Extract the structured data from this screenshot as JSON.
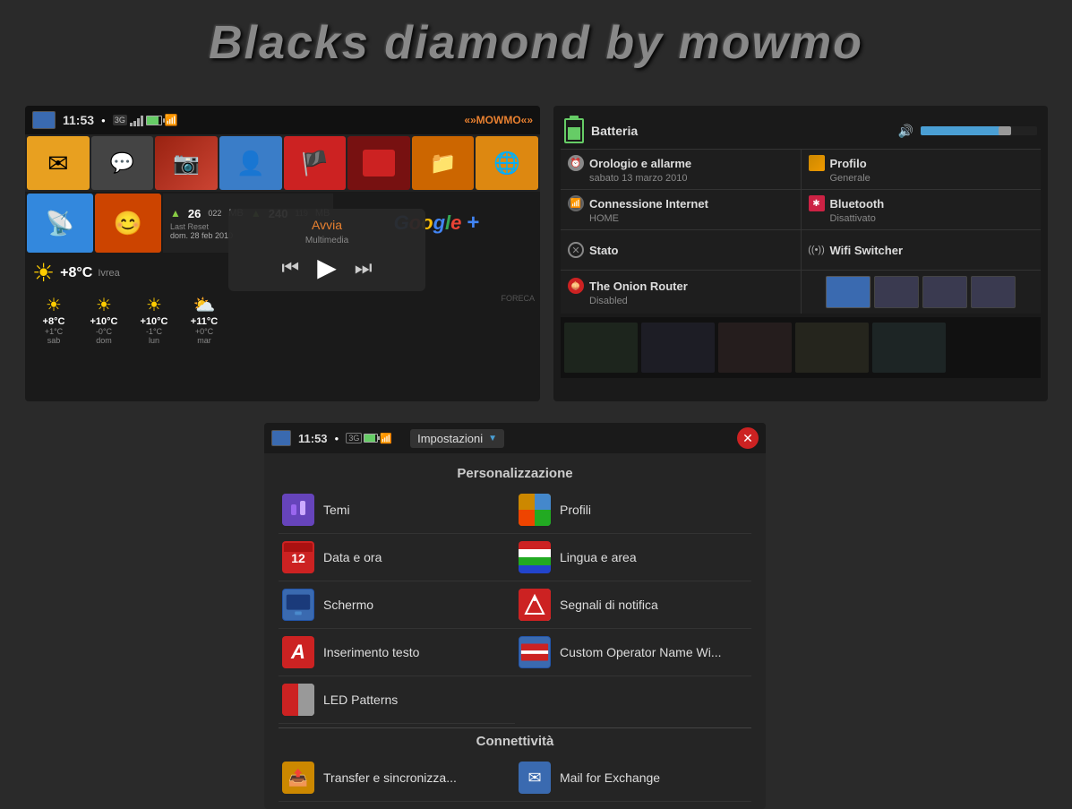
{
  "page": {
    "title": "Blacks diamond by mowmo",
    "bg_color": "#2a2a2a"
  },
  "left_screen": {
    "status_bar": {
      "time": "11:53",
      "dot": "●",
      "operator": "«»MOWMO«»",
      "network": "3G"
    },
    "apps_row1": [
      {
        "label": "Mail",
        "color": "#e8a020"
      },
      {
        "label": "Messages",
        "color": "#555"
      },
      {
        "label": "Contacts-img",
        "color": "#bb4433"
      },
      {
        "label": "Contacts",
        "color": "#3a7dc8"
      },
      {
        "label": "Flag",
        "color": "#cc3333"
      },
      {
        "label": "App",
        "color": "#881122"
      },
      {
        "label": "Files",
        "color": "#cc6600"
      },
      {
        "label": "Globe",
        "color": "#dd8811"
      }
    ],
    "apps_row2": [
      {
        "label": "RSS",
        "color": "#3388dd"
      },
      {
        "label": "Smiley",
        "color": "#cc4400"
      }
    ],
    "memory": {
      "ram_value": "26",
      "ram_sup": "022",
      "ram_unit": "MB",
      "storage_value": "240",
      "storage_sup": "119",
      "storage_unit": "MB",
      "last_reset": "Last Reset",
      "last_reset_date": "dom. 28 feb 2010"
    },
    "weather": {
      "temp": "+8°C",
      "city": "Ivrea"
    },
    "forecast": [
      {
        "day": "sab",
        "temp": "+8°C",
        "delta": "+1°C",
        "icon": "☀"
      },
      {
        "day": "dom",
        "temp": "+10°C",
        "delta": "-0°C",
        "icon": "☀"
      },
      {
        "day": "lun",
        "temp": "+10°C",
        "delta": "-1°C",
        "icon": "☀"
      },
      {
        "day": "mar",
        "temp": "+11°C",
        "delta": "+0°C",
        "icon": "⛅"
      }
    ],
    "foreca": "FORECA"
  },
  "media_popup": {
    "title": "Avvia",
    "subtitle": "Multimedia",
    "prev_btn": "⏮",
    "play_btn": "▶",
    "next_btn": "⏭"
  },
  "right_screen": {
    "battery_label": "Batteria",
    "volume_label": "Volume",
    "settings_items": [
      {
        "title": "Orologio e allarme",
        "subtitle": "sabato 13 marzo 2010",
        "icon_type": "clock"
      },
      {
        "title": "Profilo",
        "subtitle": "Generale",
        "icon_type": "profile"
      },
      {
        "title": "Connessione Internet",
        "subtitle": "HOME",
        "icon_type": "internet"
      },
      {
        "title": "Bluetooth",
        "subtitle": "Disattivato",
        "icon_type": "bluetooth"
      },
      {
        "title": "Stato",
        "subtitle": "",
        "icon_type": "stato"
      },
      {
        "title": "Wifi Switcher",
        "subtitle": "",
        "icon_type": "wifi"
      },
      {
        "title": "The Onion Router",
        "subtitle": "Disabled",
        "icon_type": "tor"
      },
      {
        "title": "",
        "subtitle": "",
        "icon_type": "screen"
      }
    ],
    "thumbnails": [
      "",
      "",
      "",
      ""
    ]
  },
  "settings_panel": {
    "status_bar": {
      "time": "11:53",
      "dot": "●",
      "dropdown_label": "Impostazioni",
      "dropdown_arrow": "▼"
    },
    "section_personalizzazione": "Personalizzazione",
    "items_left": [
      {
        "label": "Temi",
        "icon_type": "temi"
      },
      {
        "label": "Data e ora",
        "icon_type": "data"
      },
      {
        "label": "Schermo",
        "icon_type": "schermo"
      },
      {
        "label": "Inserimento testo",
        "icon_type": "inserimento"
      },
      {
        "label": "LED Patterns",
        "icon_type": "led"
      }
    ],
    "items_right": [
      {
        "label": "Profili",
        "icon_type": "profili"
      },
      {
        "label": "Lingua e area",
        "icon_type": "lingua"
      },
      {
        "label": "Segnali di notifica",
        "icon_type": "segnali"
      },
      {
        "label": "Custom Operator Name Wi...",
        "icon_type": "custom"
      }
    ],
    "section_connettivita": "Connettività",
    "conn_items_left": [
      {
        "label": "Transfer e sincronizza...",
        "icon_type": "transfer"
      }
    ],
    "conn_items_right": [
      {
        "label": "Mail for Exchange",
        "icon_type": "mail-exchange"
      }
    ]
  }
}
